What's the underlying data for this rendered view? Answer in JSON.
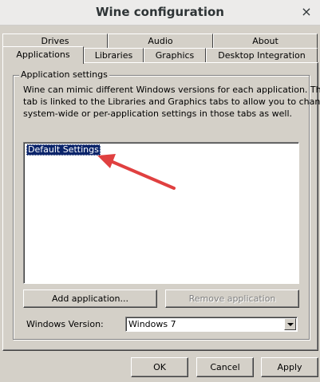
{
  "window": {
    "title": "Wine configuration",
    "close_glyph": "×"
  },
  "tabs": {
    "row1": [
      "Drives",
      "Audio",
      "About"
    ],
    "row2": [
      "Applications",
      "Libraries",
      "Graphics",
      "Desktop Integration"
    ],
    "active": "Applications"
  },
  "app_settings": {
    "group_label": "Application settings",
    "description_lines": [
      "Wine can mimic different Windows versions for each application. This",
      "tab is linked to the Libraries and Graphics tabs to allow you to change",
      "system-wide or per-application settings in those tabs as well."
    ],
    "list_items": [
      "Default Settings"
    ],
    "selected_item": "Default Settings",
    "add_button": "Add application...",
    "remove_button": "Remove application",
    "remove_enabled": false,
    "version_label": "Windows Version:",
    "version_value": "Windows 7"
  },
  "dialog_buttons": {
    "ok": "OK",
    "cancel": "Cancel",
    "apply": "Apply"
  },
  "colors": {
    "selection": "#0a246a",
    "annotation_arrow": "#e04040",
    "face": "#d4d0c8"
  },
  "icons": {
    "close": "close-icon",
    "dropdown": "chevron-down-icon"
  }
}
